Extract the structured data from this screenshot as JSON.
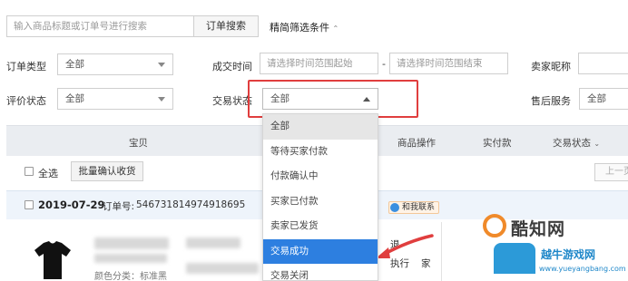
{
  "search": {
    "placeholder": "输入商品标题或订单号进行搜索",
    "button_label": "订单搜索",
    "filter_toggle": "精简筛选条件"
  },
  "filters": {
    "order_type_label": "订单类型",
    "order_type_value": "全部",
    "deal_time_label": "成交时间",
    "deal_time_start_placeholder": "请选择时间范围起始",
    "deal_time_dash": "-",
    "deal_time_end_placeholder": "请选择时间范围结束",
    "seller_nick_label": "卖家昵称",
    "review_status_label": "评价状态",
    "review_status_value": "全部",
    "trade_status_label": "交易状态",
    "trade_status_value": "全部",
    "after_sale_label": "售后服务",
    "after_sale_value": "全部"
  },
  "trade_status_options": [
    "全部",
    "等待买家付款",
    "付款确认中",
    "买家已付款",
    "卖家已发货",
    "交易成功",
    "交易关闭"
  ],
  "table": {
    "headers": [
      "宝贝",
      "商品操作",
      "实付款",
      "交易状态"
    ],
    "sort_icon": "chevron-down",
    "select_all_label": "全选",
    "batch_confirm_label": "批量确认收货",
    "prev_page_label": "上一页"
  },
  "order": {
    "date": "2019-07-29",
    "order_no_label": "订单号:",
    "order_no": "546731814974918695",
    "contact_label": "和我联系",
    "spec_label": "颜色分类：标准黑",
    "op_lines": [
      "退",
      "执行",
      "家"
    ]
  },
  "watermark": {
    "brand": "酷知网",
    "site_cn": "越牛游戏网",
    "site_url": "www.yueyangbang.com"
  },
  "colors": {
    "highlight_red": "#e03e3e",
    "selected_blue": "#2d7fe0",
    "order_row_bg": "#eef4fb",
    "header_bg": "#eaedf1"
  }
}
